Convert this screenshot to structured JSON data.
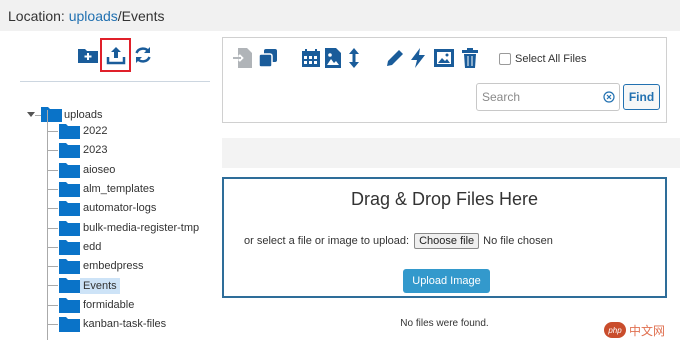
{
  "location": {
    "label": "Location: ",
    "root_link": "uploads",
    "path_rest": "/Events"
  },
  "left_toolbar": {
    "icons": [
      "add-folder-icon",
      "upload-icon",
      "refresh-icon"
    ],
    "highlighted": "upload-icon",
    "highlight_color": "#e0202a"
  },
  "tree": {
    "root": "uploads",
    "items": [
      {
        "label": "2022"
      },
      {
        "label": "2023"
      },
      {
        "label": "aioseo"
      },
      {
        "label": "alm_templates"
      },
      {
        "label": "automator-logs"
      },
      {
        "label": "bulk-media-register-tmp"
      },
      {
        "label": "edd"
      },
      {
        "label": "embedpress"
      },
      {
        "label": "Events",
        "selected": true
      },
      {
        "label": "formidable"
      },
      {
        "label": "kanban-task-files"
      }
    ],
    "folder_color": "#0a73c8"
  },
  "toolbox": {
    "icons": [
      "import-icon",
      "copy-icon",
      "calendar-icon",
      "image-icon",
      "resize-icon",
      "edit-icon",
      "flash-icon",
      "picture-icon",
      "trash-icon"
    ],
    "select_all_label": "Select All Files",
    "search": {
      "placeholder": "Search",
      "value": ""
    },
    "find_label": "Find"
  },
  "dropzone": {
    "title": "Drag & Drop Files Here",
    "select_label": "or select a file or image to upload:",
    "choose_label": "Choose file",
    "no_file_label": "No file chosen",
    "upload_label": "Upload Image"
  },
  "status": {
    "no_files": "No files were found."
  },
  "watermark": {
    "badge": "php",
    "text": "中文网"
  },
  "colors": {
    "accent": "#2271b1",
    "icon_blue": "#1a5c9a",
    "upload_button": "#3399cc",
    "dropzone_border": "#2e6d99"
  }
}
